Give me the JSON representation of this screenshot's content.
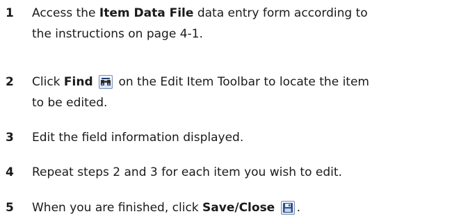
{
  "steps": [
    {
      "number": "1",
      "line1_pre": "Access the ",
      "line1_bold": "Item Data File",
      "line1_post": " data entry form according to",
      "line2": "the instructions on page 4-1."
    },
    {
      "number": "2",
      "pre": "Click ",
      "bold": "Find",
      "icon": "find-binoculars-icon",
      "post": " on the Edit Item Toolbar to locate the item",
      "line2": "to be edited."
    },
    {
      "number": "3",
      "text": "Edit the field information displayed."
    },
    {
      "number": "4",
      "text": "Repeat steps 2 and 3 for each item you wish to edit."
    },
    {
      "number": "5",
      "pre": "When you are finished, click ",
      "bold": "Save/Close",
      "icon": "save-close-disk-icon",
      "post": "."
    }
  ]
}
